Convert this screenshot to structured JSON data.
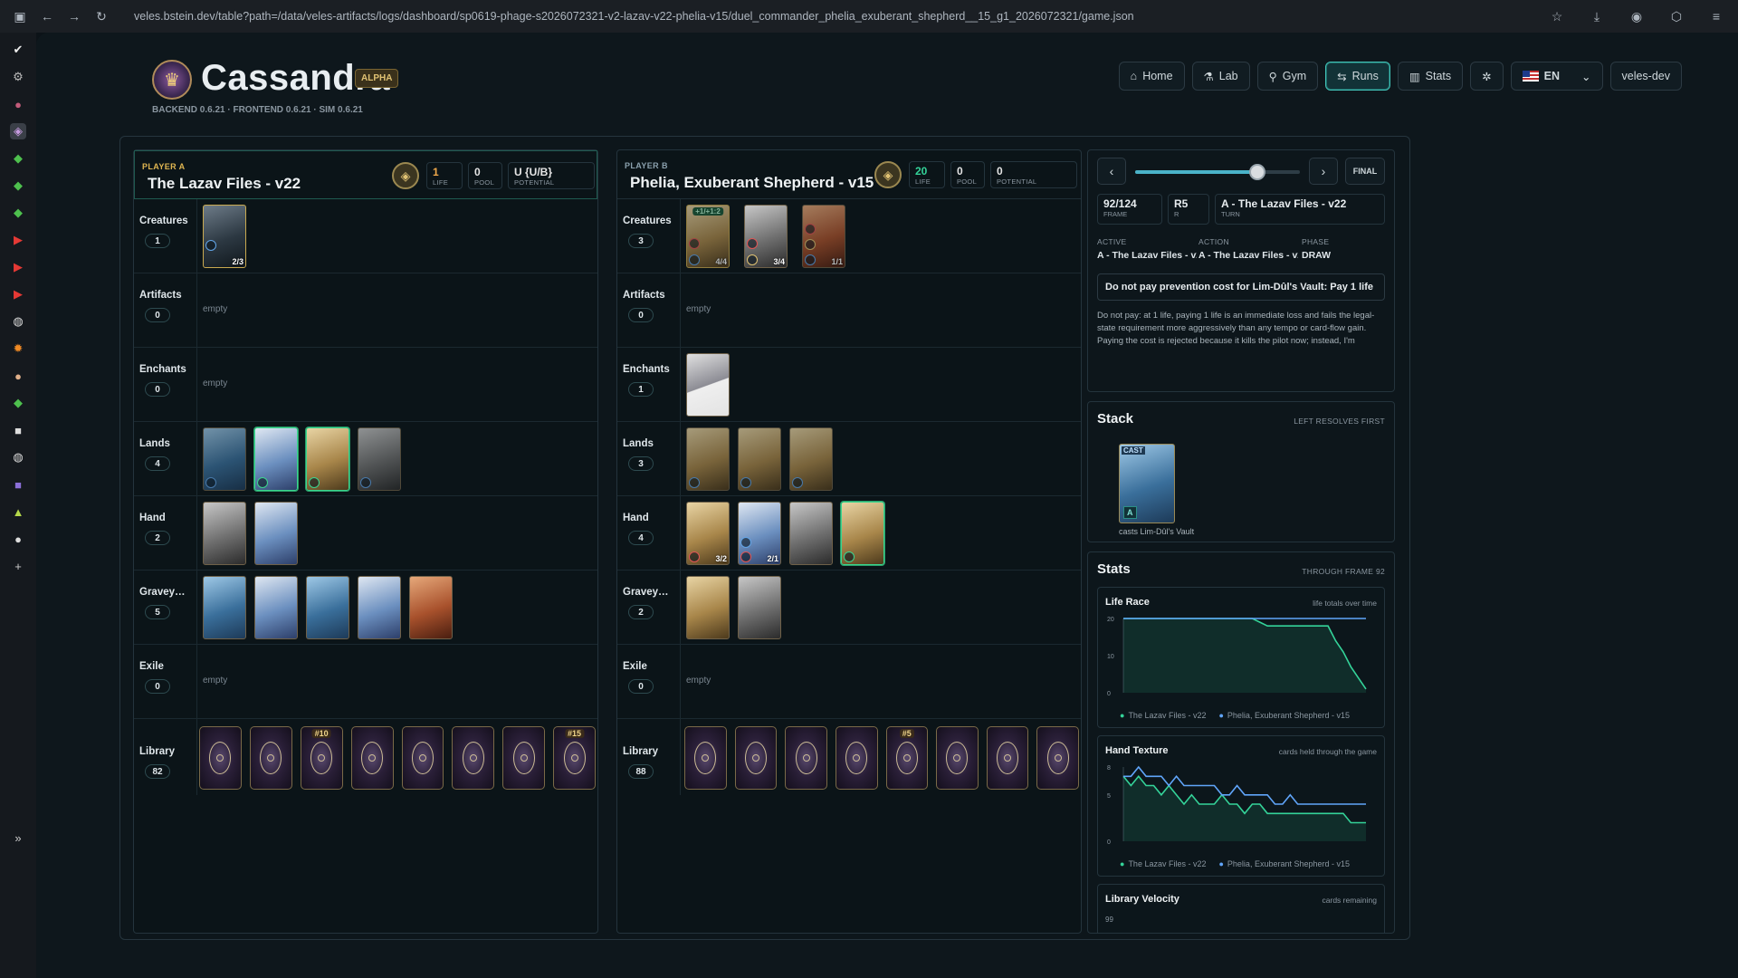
{
  "browser": {
    "url": "veles.bstein.dev/table?path=/data/veles-artifacts/logs/dashboard/sp0619-phage-s2026072321-v2-lazav-v22-phelia-v15/duel_commander_phelia_exuberant_shepherd__15_g1_2026072321/game.json"
  },
  "app": {
    "title": "Cassandra",
    "badge": "ALPHA",
    "version": "BACKEND 0.6.21 · FRONTEND 0.6.21 · SIM 0.6.21"
  },
  "nav": {
    "home": "Home",
    "lab": "Lab",
    "gym": "Gym",
    "runs": "Runs",
    "stats": "Stats",
    "lang": "EN",
    "user": "veles-dev",
    "active": "Runs"
  },
  "players": {
    "a": {
      "label": "PLAYER A",
      "name": "The Lazav Files - v22",
      "life": "1",
      "life_k": "LIFE",
      "pool": "0",
      "pool_k": "POOL",
      "potential": "U {U/B}",
      "potential_k": "POTENTIAL",
      "zones": {
        "creatures": {
          "name": "Creatures",
          "count": "1"
        },
        "artifacts": {
          "name": "Artifacts",
          "count": "0",
          "empty": "empty"
        },
        "enchants": {
          "name": "Enchants",
          "count": "0",
          "empty": "empty"
        },
        "lands": {
          "name": "Lands",
          "count": "4"
        },
        "hand": {
          "name": "Hand",
          "count": "2"
        },
        "graveyard": {
          "name": "Gravey…",
          "count": "5"
        },
        "exile": {
          "name": "Exile",
          "count": "0",
          "empty": "empty"
        },
        "library": {
          "name": "Library",
          "count": "82"
        }
      },
      "creature_pt": [
        "2/3"
      ],
      "library_tags": [
        "",
        "",
        "#10",
        "",
        "",
        "",
        "",
        "#15"
      ]
    },
    "b": {
      "label": "PLAYER B",
      "name": "Phelia, Exuberant Shepherd - v15",
      "life": "20",
      "life_k": "LIFE",
      "pool": "0",
      "pool_k": "POOL",
      "potential": "0",
      "potential_k": "POTENTIAL",
      "zones": {
        "creatures": {
          "name": "Creatures",
          "count": "3"
        },
        "artifacts": {
          "name": "Artifacts",
          "count": "0",
          "empty": "empty"
        },
        "enchants": {
          "name": "Enchants",
          "count": "1"
        },
        "lands": {
          "name": "Lands",
          "count": "3"
        },
        "hand": {
          "name": "Hand",
          "count": "4"
        },
        "graveyard": {
          "name": "Gravey…",
          "count": "2"
        },
        "exile": {
          "name": "Exile",
          "count": "0",
          "empty": "empty"
        },
        "library": {
          "name": "Library",
          "count": "88"
        }
      },
      "creature_pt": [
        "4/4",
        "3/4",
        "1/1"
      ],
      "creature_tag": "+1/+1:2",
      "hand_pt": [
        "3/2",
        "2/1"
      ],
      "library_tags": [
        "",
        "",
        "",
        "",
        "#5",
        "",
        "",
        ""
      ]
    }
  },
  "replay": {
    "frame": "92/124",
    "frame_k": "FRAME",
    "round": "R5",
    "round_k": "R",
    "turn": "A - The Lazav Files - v22",
    "turn_k": "TURN",
    "final": "FINAL",
    "progress": 0.74,
    "active_k": "ACTIVE",
    "active": "A - The Lazav Files - v22",
    "action_k": "ACTION",
    "action": "A - The Lazav Files - v22",
    "phase_k": "PHASE",
    "phase": "DRAW",
    "action_text": "Do not pay prevention cost for Lim-Dûl's Vault: Pay 1 life",
    "reason": "Do not pay: at 1 life, paying 1 life is an immediate loss and fails the legal-state requirement more aggressively than any tempo or card-flow gain. Paying the cost is rejected because it kills the pilot now; instead, I'm"
  },
  "stack": {
    "title": "Stack",
    "sub": "LEFT RESOLVES FIRST",
    "card_tag": "CAST",
    "owner": "A",
    "caption": "casts Lim-Dûl's Vault"
  },
  "stats": {
    "title": "Stats",
    "sub": "THROUGH FRAME 92",
    "legend_a": "The Lazav Files - v22",
    "legend_b": "Phelia, Exuberant Shepherd - v15",
    "life_race": {
      "title": "Life Race",
      "sub": "life totals over time"
    },
    "hand_texture": {
      "title": "Hand Texture",
      "sub": "cards held through the game"
    },
    "library_velocity": {
      "title": "Library Velocity",
      "sub": "cards remaining",
      "y_top": "99"
    }
  },
  "colors": {
    "accent": "#42c2b8",
    "player_a": "#34d399",
    "player_b": "#60a5fa",
    "gold": "#e0c273"
  },
  "chart_data": [
    {
      "type": "line",
      "title": "Life Race",
      "ylim": [
        0,
        20
      ],
      "yticks": [
        0,
        10,
        20
      ],
      "series": [
        {
          "name": "The Lazav Files - v22",
          "values": [
            20,
            20,
            20,
            20,
            20,
            20,
            20,
            20,
            20,
            20,
            20,
            20,
            20,
            20,
            20,
            20,
            20,
            20,
            19,
            18,
            18,
            18,
            18,
            18,
            18,
            18,
            18,
            18,
            14,
            11,
            7,
            4,
            1
          ]
        },
        {
          "name": "Phelia, Exuberant Shepherd - v15",
          "values": [
            20,
            20,
            20,
            20,
            20,
            20,
            20,
            20,
            20,
            20,
            20,
            20,
            20,
            20,
            20,
            20,
            20,
            20,
            20,
            20,
            20,
            20,
            20,
            20,
            20,
            20,
            20,
            20,
            20,
            20,
            20,
            20,
            20
          ]
        }
      ]
    },
    {
      "type": "line",
      "title": "Hand Texture",
      "ylim": [
        0,
        8
      ],
      "yticks": [
        0,
        5,
        8
      ],
      "series": [
        {
          "name": "The Lazav Files - v22",
          "values": [
            7,
            6,
            7,
            6,
            6,
            5,
            6,
            5,
            4,
            5,
            4,
            4,
            4,
            5,
            4,
            4,
            3,
            4,
            4,
            3,
            3,
            3,
            3,
            3,
            3,
            3,
            3,
            3,
            3,
            3,
            2,
            2,
            2
          ]
        },
        {
          "name": "Phelia, Exuberant Shepherd - v15",
          "values": [
            7,
            7,
            8,
            7,
            7,
            7,
            6,
            7,
            6,
            6,
            6,
            6,
            6,
            5,
            5,
            6,
            5,
            5,
            5,
            5,
            4,
            4,
            5,
            4,
            4,
            4,
            4,
            4,
            4,
            4,
            4,
            4,
            4
          ]
        }
      ]
    }
  ]
}
